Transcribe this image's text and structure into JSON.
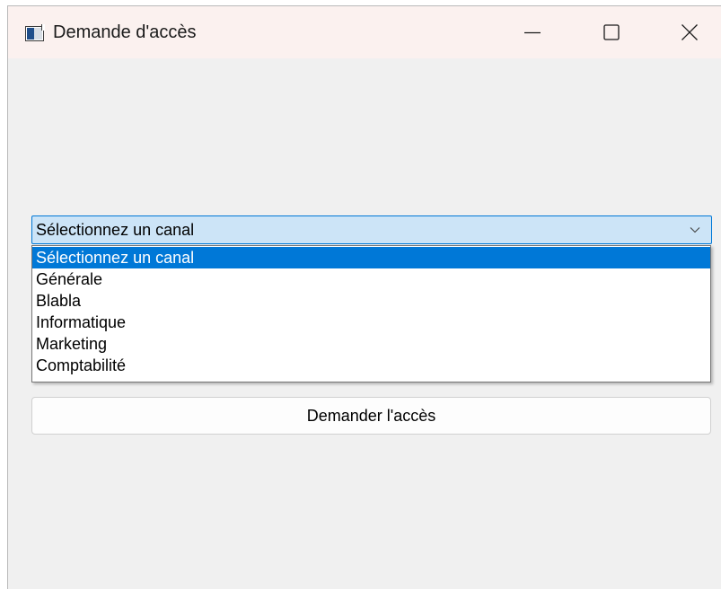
{
  "window": {
    "title": "Demande d'accès",
    "icon": "app-window-icon",
    "controls": {
      "minimize_icon": "minimize-icon",
      "maximize_icon": "maximize-icon",
      "close_icon": "close-icon"
    }
  },
  "channel_select": {
    "selected_value": "Sélectionnez un canal",
    "arrow_icon": "chevron-down-icon",
    "options": [
      "Sélectionnez un canal",
      "Générale",
      "Blabla",
      "Informatique",
      "Marketing",
      "Comptabilité"
    ],
    "highlighted_option": "Sélectionnez un canal"
  },
  "request_button": {
    "label": "Demander l'accès"
  },
  "colors": {
    "selection_blue": "#0078d7",
    "combo_background": "#cce4f7",
    "titlebar_background": "#fbf1ef",
    "window_background": "#f0f0f0"
  }
}
